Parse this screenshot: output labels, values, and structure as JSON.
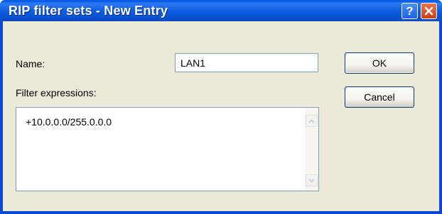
{
  "window": {
    "title": "RIP filter sets - New Entry",
    "help_label": "?"
  },
  "form": {
    "name_label": "Name:",
    "name_value": "LAN1",
    "filter_label": "Filter expressions:",
    "filter_value": "+10.0.0.0/255.0.0.0"
  },
  "buttons": {
    "ok_label": "OK",
    "cancel_label": "Cancel"
  },
  "icons": {
    "help": "question-mark-icon",
    "close": "close-x-icon",
    "scroll_up": "chevron-up-icon",
    "scroll_down": "chevron-down-icon"
  },
  "colors": {
    "titlebar": "#0a5ee7",
    "dialog_face": "#ece9d8",
    "close_button": "#c8431c"
  }
}
